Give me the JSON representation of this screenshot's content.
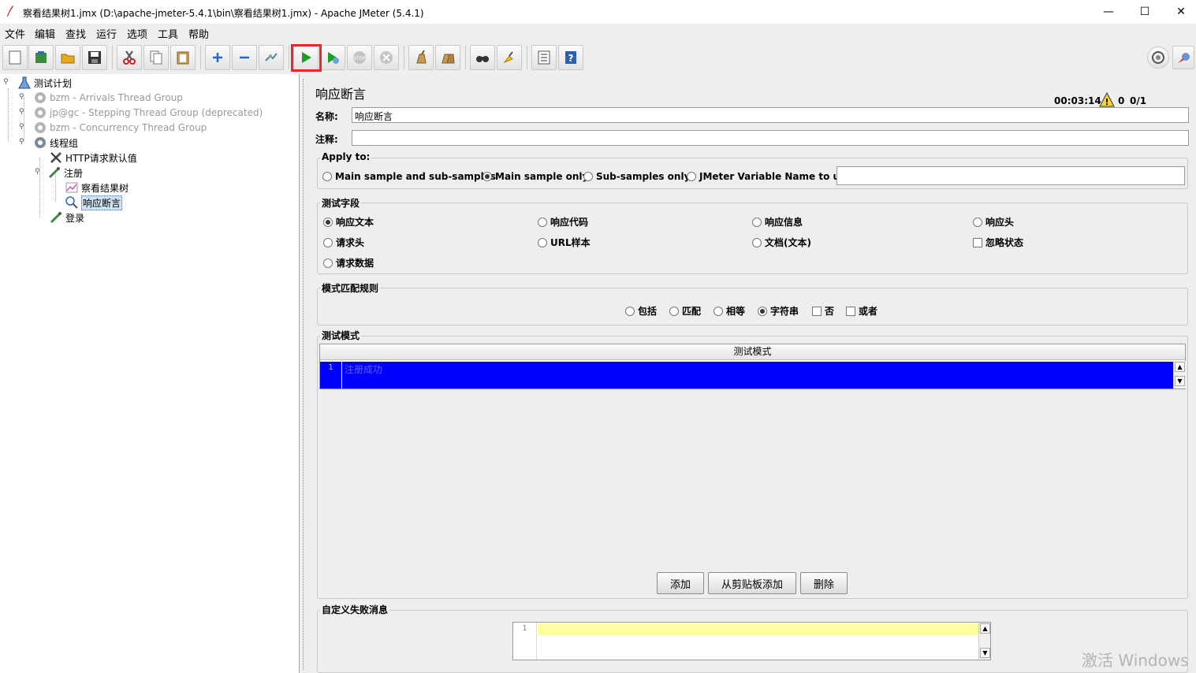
{
  "window": {
    "title": "察看结果树1.jmx (D:\\apache-jmeter-5.4.1\\bin\\察看结果树1.jmx) - Apache JMeter (5.4.1)",
    "controls": {
      "minimize": "—",
      "maximize": "☐",
      "close": "✕"
    }
  },
  "menu": [
    "文件",
    "编辑",
    "查找",
    "运行",
    "选项",
    "工具",
    "帮助"
  ],
  "toolbar": {
    "buttons": [
      "new-icon",
      "templates-icon",
      "open-icon",
      "save-icon",
      "cut-icon",
      "copy-icon",
      "paste-icon",
      "expand-icon",
      "collapse-icon",
      "toggle-icon",
      "start-icon",
      "start-no-pause-icon",
      "stop-icon",
      "shutdown-icon",
      "clear-icon",
      "clear-all-icon",
      "search-icon",
      "reset-search-icon",
      "function-helper-icon",
      "help-icon"
    ],
    "highlighted": "start-icon",
    "timer": "00:03:14",
    "warnings": "0",
    "threads": "0/1"
  },
  "tree": {
    "items": [
      {
        "label": "测试计划",
        "icon": "test-plan-icon",
        "disabled": false
      },
      {
        "label": "bzm - Arrivals Thread Group",
        "icon": "gear-icon",
        "disabled": true
      },
      {
        "label": "jp@gc - Stepping Thread Group (deprecated)",
        "icon": "gear-icon",
        "disabled": true
      },
      {
        "label": "bzm - Concurrency Thread Group",
        "icon": "gear-icon",
        "disabled": true
      },
      {
        "label": "线程组",
        "icon": "gear-icon",
        "disabled": false
      },
      {
        "label": "HTTP请求默认值",
        "icon": "wrench-icon",
        "disabled": false
      },
      {
        "label": "注册",
        "icon": "pipette-icon",
        "disabled": false
      },
      {
        "label": "察看结果树",
        "icon": "chart-icon",
        "disabled": false
      },
      {
        "label": "响应断言",
        "icon": "magnifier-icon",
        "disabled": false,
        "selected": true
      },
      {
        "label": "登录",
        "icon": "pipette-icon",
        "disabled": false
      }
    ]
  },
  "editor": {
    "title": "响应断言",
    "name_label": "名称:",
    "name_value": "响应断言",
    "comment_label": "注释:",
    "comment_value": "",
    "apply_to": {
      "title": "Apply to:",
      "options": [
        "Main sample and sub-samples",
        "Main sample only",
        "Sub-samples only",
        "JMeter Variable Name to use"
      ],
      "selected": "Main sample only",
      "variable_value": ""
    },
    "field_to_test": {
      "title": "测试字段",
      "options": [
        "响应文本",
        "响应代码",
        "响应信息",
        "响应头",
        "请求头",
        "URL样本",
        "文档(文本)",
        "请求数据"
      ],
      "selected": "响应文本",
      "ignore_status_label": "忽略状态",
      "ignore_status_checked": false
    },
    "matching_rules": {
      "title": "模式匹配规则",
      "options": [
        "包括",
        "匹配",
        "相等",
        "字符串"
      ],
      "selected": "字符串",
      "not_label": "否",
      "or_label": "或者"
    },
    "patterns": {
      "title": "测试模式",
      "column_header": "测试模式",
      "rows": [
        {
          "line": "1",
          "value": "注册成功"
        }
      ]
    },
    "buttons": {
      "add": "添加",
      "add_clipboard": "从剪贴板添加",
      "delete": "删除"
    },
    "failure_message": {
      "title": "自定义失败消息",
      "line_number": "1",
      "value": ""
    }
  },
  "watermark": "激活 Windows",
  "colors": {
    "selection_blue": "#0000ff",
    "highlight_red": "#e8262b",
    "editor_line": "#fefea0"
  }
}
